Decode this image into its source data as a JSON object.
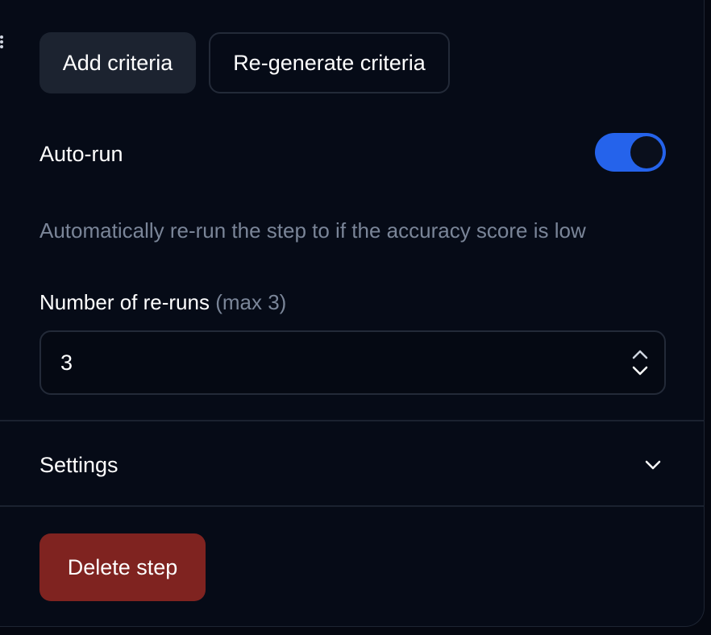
{
  "criteria": {
    "add_label": "Add criteria",
    "regenerate_label": "Re-generate criteria"
  },
  "auto_run": {
    "label": "Auto-run",
    "enabled": true,
    "description": "Automatically re-run the step to if the accuracy score is low"
  },
  "reruns": {
    "label": "Number of re-runs",
    "hint": "(max 3)",
    "value": "3"
  },
  "settings": {
    "label": "Settings"
  },
  "delete": {
    "label": "Delete step"
  },
  "colors": {
    "accent": "#2563eb",
    "danger": "#7f2320",
    "background": "#060b17",
    "muted_text": "#7a8598"
  },
  "icons": {
    "drag": "drag-handle-icon",
    "stepper": "chevron-up-down-icon",
    "settings": "chevron-down-icon"
  }
}
